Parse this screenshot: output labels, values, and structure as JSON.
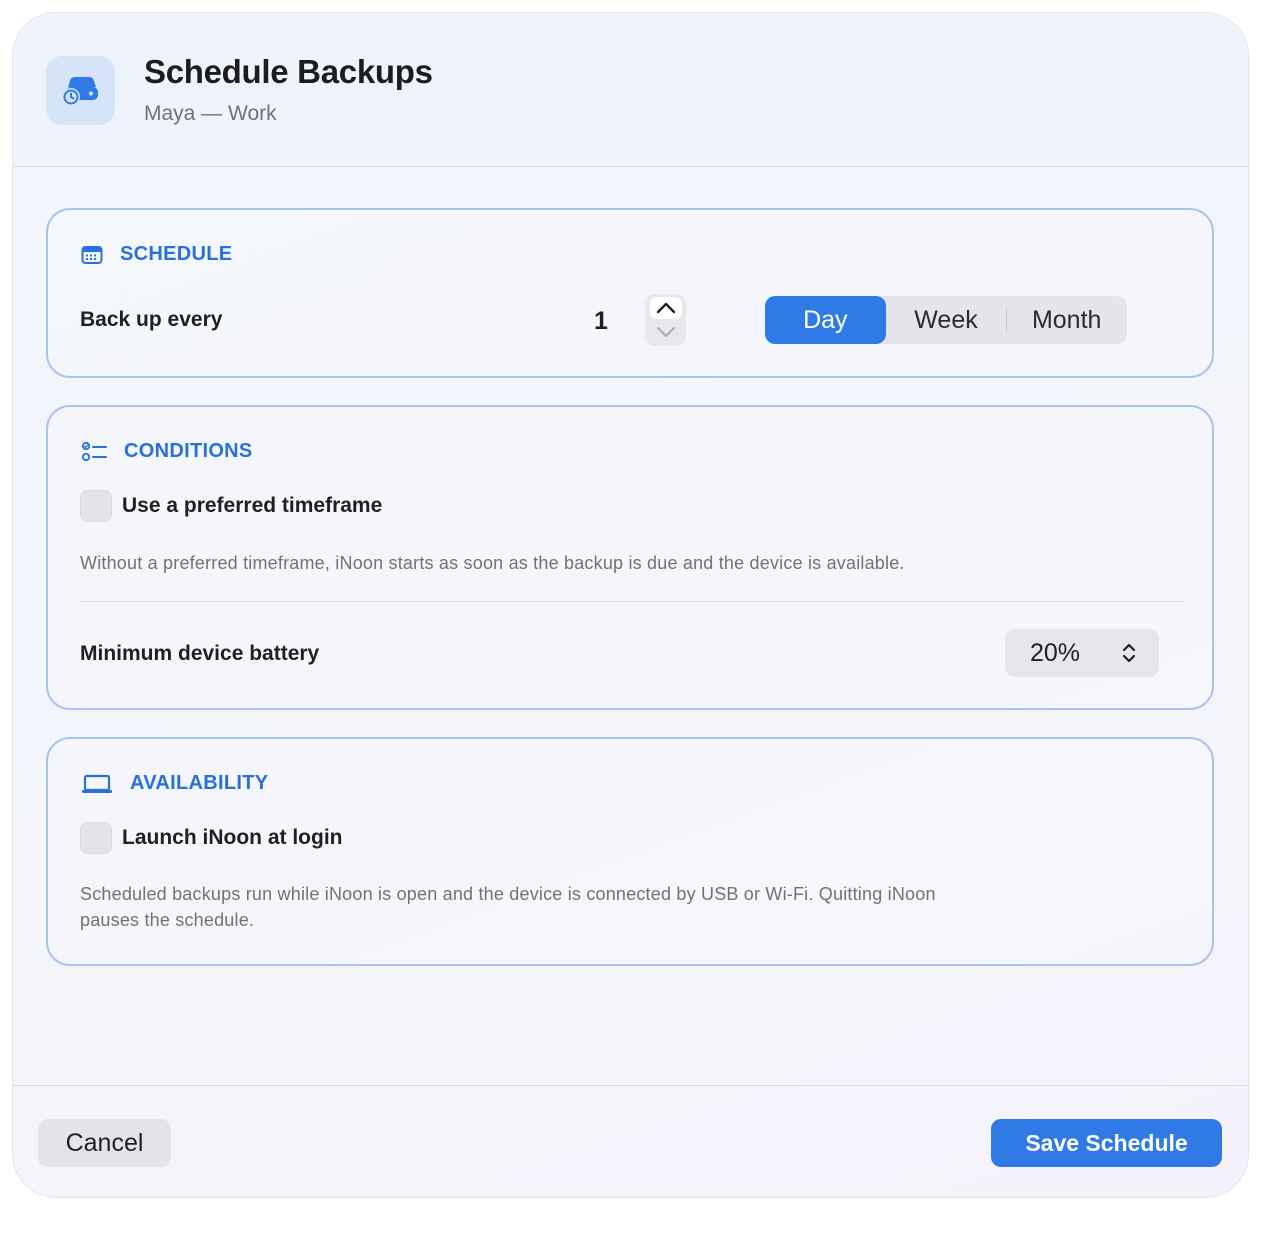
{
  "header": {
    "title": "Schedule Backups",
    "subtitle": "Maya — Work",
    "icon": "drive-history-icon"
  },
  "schedule": {
    "section_title": "SCHEDULE",
    "icon": "calendar-icon",
    "row_label": "Back up every",
    "interval_value": "1",
    "units": [
      "Day",
      "Week",
      "Month"
    ],
    "selected_unit": "Day"
  },
  "conditions": {
    "section_title": "CONDITIONS",
    "icon": "checklist-icon",
    "timeframe_label": "Use a preferred timeframe",
    "timeframe_checked": false,
    "timeframe_help": "Without a preferred timeframe, iNoon starts as soon as the backup is due and the device is available.",
    "battery_label": "Minimum device battery",
    "battery_value": "20%"
  },
  "availability": {
    "section_title": "AVAILABILITY",
    "icon": "laptop-icon",
    "launch_label": "Launch iNoon at login",
    "launch_checked": false,
    "help_line1": "Scheduled backups run while iNoon is open and the device is connected by USB or Wi-Fi. Quitting iNoon",
    "help_line2": "pauses the schedule."
  },
  "footer": {
    "cancel_label": "Cancel",
    "save_label": "Save Schedule"
  },
  "colors": {
    "accent": "#2f7ae5",
    "section_title": "#2a6fde",
    "card_border": "#a7c4ee"
  }
}
